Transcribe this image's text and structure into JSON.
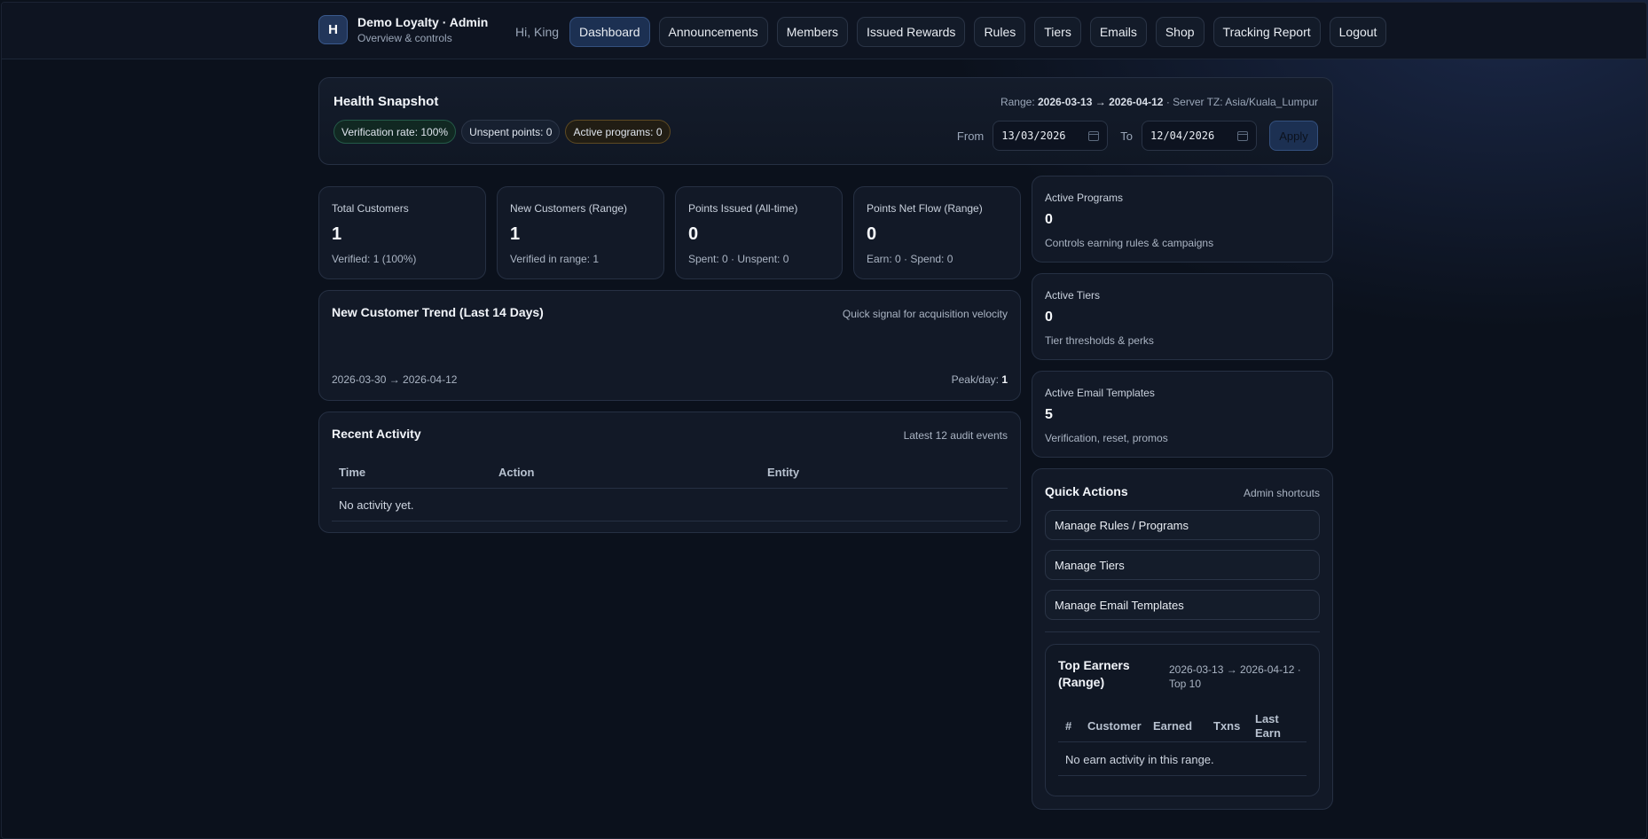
{
  "header": {
    "logo_letter": "H",
    "title": "Demo Loyalty · Admin",
    "subtitle": "Overview & controls",
    "greeting": "Hi, King",
    "nav": [
      {
        "label": "Dashboard",
        "active": true
      },
      {
        "label": "Announcements"
      },
      {
        "label": "Members"
      },
      {
        "label": "Issued Rewards"
      },
      {
        "label": "Rules"
      },
      {
        "label": "Tiers"
      },
      {
        "label": "Emails"
      },
      {
        "label": "Shop"
      },
      {
        "label": "Tracking Report"
      },
      {
        "label": "Logout"
      }
    ]
  },
  "snapshot": {
    "title": "Health Snapshot",
    "pills": [
      "Verification rate: 100%",
      "Unspent points: 0",
      "Active programs: 0"
    ],
    "range_prefix": "Range:",
    "range_start": "2026-03-13",
    "range_arrow": "→",
    "range_end": "2026-04-12",
    "server_tz": "· Server TZ: Asia/Kuala_Lumpur",
    "from_label": "From",
    "from_value": "13/03/2026",
    "to_label": "To",
    "to_value": "12/04/2026",
    "apply_label": "Apply"
  },
  "stats": [
    {
      "label": "Total Customers",
      "value": "1",
      "sub": "Verified: 1 (100%)"
    },
    {
      "label": "New Customers (Range)",
      "value": "1",
      "sub": "Verified in range: 1"
    },
    {
      "label": "Points Issued (All-time)",
      "value": "0",
      "sub": "Spent: 0 · Unspent: 0"
    },
    {
      "label": "Points Net Flow (Range)",
      "value": "0",
      "sub": "Earn: 0 · Spend: 0"
    }
  ],
  "side_stats": [
    {
      "label": "Active Programs",
      "value": "0",
      "sub": "Controls earning rules & campaigns"
    },
    {
      "label": "Active Tiers",
      "value": "0",
      "sub": "Tier thresholds & perks"
    },
    {
      "label": "Active Email Templates",
      "value": "5",
      "sub": "Verification, reset, promos"
    }
  ],
  "trend": {
    "title": "New Customer Trend (Last 14 Days)",
    "note": "Quick signal for acquisition velocity",
    "range": "2026-03-30 → 2026-04-12",
    "peak_label": "Peak/day:",
    "peak_value": "1"
  },
  "activity": {
    "title": "Recent Activity",
    "note": "Latest 12 audit events",
    "columns": [
      "Time",
      "Action",
      "Entity"
    ],
    "empty": "No activity yet."
  },
  "quick_actions": {
    "title": "Quick Actions",
    "note": "Admin shortcuts",
    "buttons": [
      "Manage Rules / Programs",
      "Manage Tiers",
      "Manage Email Templates"
    ]
  },
  "top_earners": {
    "title": "Top Earners (Range)",
    "note": "2026-03-13 → 2026-04-12 · Top 10",
    "columns": [
      "#",
      "Customer",
      "Earned",
      "Txns",
      "Last Earn"
    ],
    "empty": "No earn activity in this range."
  }
}
